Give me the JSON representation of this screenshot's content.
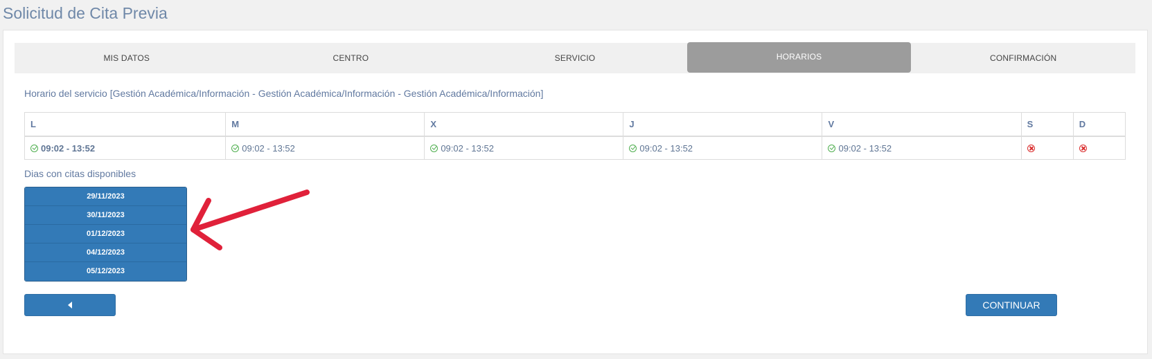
{
  "page": {
    "title": "Solicitud de Cita Previa"
  },
  "wizard": {
    "steps": [
      {
        "label": "MIS DATOS"
      },
      {
        "label": "CENTRO"
      },
      {
        "label": "SERVICIO"
      },
      {
        "label": "HORARIOS",
        "active": true
      },
      {
        "label": "CONFIRMACIÓN"
      }
    ]
  },
  "schedule": {
    "caption": "Horario del servicio [Gestión Académica/Información - Gestión Académica/Información - Gestión Académica/Información]",
    "days": [
      {
        "header": "L",
        "value": "09:02 - 13:52",
        "status": "available",
        "icon": "check-circle-icon"
      },
      {
        "header": "M",
        "value": "09:02 - 13:52",
        "status": "available",
        "icon": "check-circle-icon"
      },
      {
        "header": "X",
        "value": "09:02 - 13:52",
        "status": "available",
        "icon": "check-circle-icon"
      },
      {
        "header": "J",
        "value": "09:02 - 13:52",
        "status": "available",
        "icon": "check-circle-icon"
      },
      {
        "header": "V",
        "value": "09:02 - 13:52",
        "status": "available",
        "icon": "check-circle-icon"
      },
      {
        "header": "S",
        "value": "",
        "status": "closed",
        "icon": "times-circle-icon"
      },
      {
        "header": "D",
        "value": "",
        "status": "closed",
        "icon": "times-circle-icon"
      }
    ]
  },
  "available_days": {
    "label": "Dias con citas disponibles",
    "dates": [
      "29/11/2023",
      "30/11/2023",
      "01/12/2023",
      "04/12/2023",
      "05/12/2023"
    ]
  },
  "actions": {
    "back_icon": "caret-left-icon",
    "continue_label": "CONTINUAR"
  },
  "colors": {
    "primary": "#337ab7",
    "active_step": "#9c9c9c",
    "available": "#4fae4f",
    "closed": "#d92c2c",
    "annotation_arrow": "#e0213a"
  }
}
